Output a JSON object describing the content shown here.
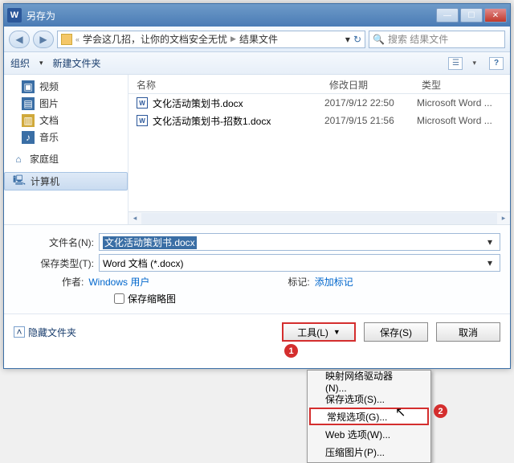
{
  "title": "另存为",
  "breadcrumb": {
    "seg1": "学会这几招，让你的文档安全无忧",
    "seg2": "结果文件"
  },
  "search_placeholder": "搜索 结果文件",
  "toolbar": {
    "organize": "组织",
    "newfolder": "新建文件夹"
  },
  "nav": {
    "video": "视频",
    "pictures": "图片",
    "documents": "文档",
    "music": "音乐",
    "homegroup": "家庭组",
    "computer": "计算机"
  },
  "columns": {
    "name": "名称",
    "date": "修改日期",
    "type": "类型"
  },
  "files": [
    {
      "name": "文化活动策划书.docx",
      "date": "2017/9/12 22:50",
      "type": "Microsoft Word ..."
    },
    {
      "name": "文化活动策划书-招数1.docx",
      "date": "2017/9/15 21:56",
      "type": "Microsoft Word ..."
    }
  ],
  "form": {
    "filename_label": "文件名(N):",
    "filename_value": "文化活动策划书.docx",
    "savetype_label": "保存类型(T):",
    "savetype_value": "Word 文档 (*.docx)",
    "author_label": "作者:",
    "author_value": "Windows 用户",
    "tag_label": "标记:",
    "tag_value": "添加标记",
    "thumb_label": "保存缩略图"
  },
  "buttons": {
    "hide": "隐藏文件夹",
    "tools": "工具(L)",
    "save": "保存(S)",
    "cancel": "取消"
  },
  "menu": {
    "map_drive": "映射网络驱动器(N)...",
    "save_opts": "保存选项(S)...",
    "general_opts": "常规选项(G)...",
    "web_opts": "Web 选项(W)...",
    "compress": "压缩图片(P)..."
  },
  "badges": {
    "b1": "1",
    "b2": "2"
  }
}
